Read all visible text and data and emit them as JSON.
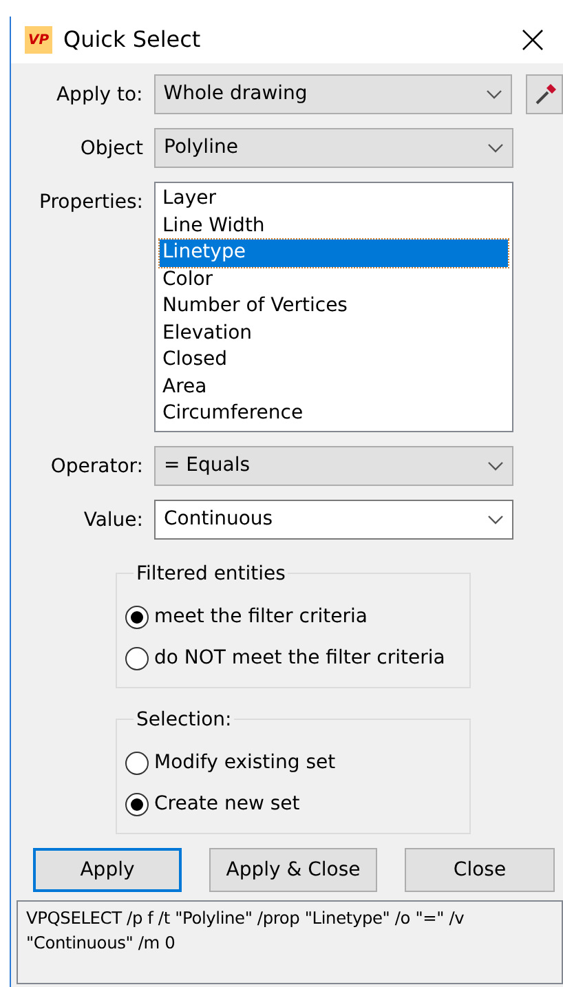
{
  "window": {
    "logo": "VP",
    "title": "Quick Select"
  },
  "fields": [
    {
      "kind": "dropdown",
      "label": "Apply to:",
      "value": "Whole drawing",
      "picker": true
    },
    {
      "kind": "dropdown",
      "label": "Object",
      "value": "Polyline"
    },
    {
      "kind": "listbox",
      "label": "Properties:",
      "items": [
        {
          "label": "Layer",
          "selected": false
        },
        {
          "label": "Line Width",
          "selected": false
        },
        {
          "label": "Linetype",
          "selected": true
        },
        {
          "label": "Color",
          "selected": false
        },
        {
          "label": "Number of Vertices",
          "selected": false
        },
        {
          "label": "Elevation",
          "selected": false
        },
        {
          "label": "Closed",
          "selected": false
        },
        {
          "label": "Area",
          "selected": false
        },
        {
          "label": "Circumference",
          "selected": false
        }
      ]
    },
    {
      "kind": "dropdown",
      "label": "Operator:",
      "value": "=  Equals"
    },
    {
      "kind": "editable",
      "label": "Value:",
      "value": "Continuous"
    }
  ],
  "groups": [
    {
      "title": "Filtered entities",
      "options": [
        {
          "label": "meet the filter criteria",
          "selected": true
        },
        {
          "label": "do NOT meet the filter criteria",
          "selected": false
        }
      ]
    },
    {
      "title": "Selection:",
      "options": [
        {
          "label": "Modify existing set",
          "selected": false
        },
        {
          "label": "Create new set",
          "selected": true
        }
      ]
    }
  ],
  "buttons": [
    {
      "label": "Apply",
      "default": true
    },
    {
      "label": "Apply & Close",
      "default": false
    },
    {
      "label": "Close",
      "default": false
    }
  ],
  "command": "VPQSELECT /p f /t \"Polyline\" /prop \"Linetype\" /o \"=\" /v \"Continuous\" /m 0"
}
